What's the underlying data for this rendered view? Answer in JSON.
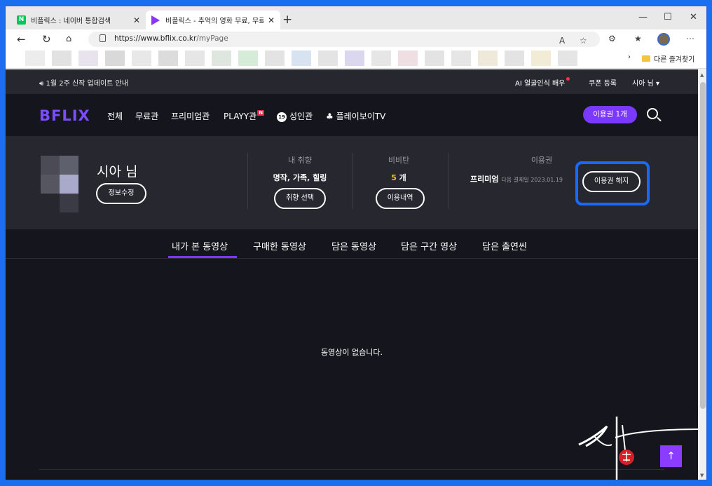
{
  "browser": {
    "tabs": [
      {
        "title": "비플릭스 : 네이버 통합검색",
        "close": "✕"
      },
      {
        "title": "비플릭스 - 추억의 영화 무료, 무료",
        "close": "✕"
      }
    ],
    "new_tab": "+",
    "window_controls": {
      "minimize": "—",
      "maximize": "☐",
      "close": "✕"
    },
    "url_host": "https://www.bflix.co.kr",
    "url_path": "/myPage",
    "bookmark_folder": "다른 즐겨찾기",
    "bookmark_chevron": "›"
  },
  "site": {
    "notice": "1월 2주 신작 업데이트 안내",
    "top_right": {
      "ai": "AI 얼굴인식 배우",
      "coupon": "쿠폰 등록",
      "user": "시아 님 ▾"
    },
    "logo": "BFLIX",
    "nav": {
      "all": "전체",
      "free": "무료관",
      "premium": "프리미엄관",
      "playy": "PLAYY관",
      "playy_badge": "N",
      "adult_badge": "19",
      "adult": "성인관",
      "playboy": "플레이보이TV"
    },
    "pass_button": "이용권 1개"
  },
  "profile": {
    "name": "시아 님",
    "edit_button": "정보수정",
    "taste": {
      "title": "내 취향",
      "value": "명작, 가족, 힐링",
      "button": "취향 선택"
    },
    "vivitan": {
      "title": "비비탄",
      "count": "5",
      "unit": " 개",
      "button": "이용내역"
    },
    "subscription": {
      "title": "이용권",
      "plan": "프리미엄",
      "next_payment": "다음 결제일 2023.01.19",
      "cancel_button": "이용권 해지"
    }
  },
  "content_tabs": [
    "내가 본 동영상",
    "구매한 동영상",
    "담은 동영상",
    "담은 구간 영상",
    "담은 출연씬"
  ],
  "empty_message": "동영상이 없습니다.",
  "scroll_top": "↑",
  "colors": {
    "accent": "#7b38ff",
    "highlight": "#1869ff",
    "background": "#15161d"
  }
}
